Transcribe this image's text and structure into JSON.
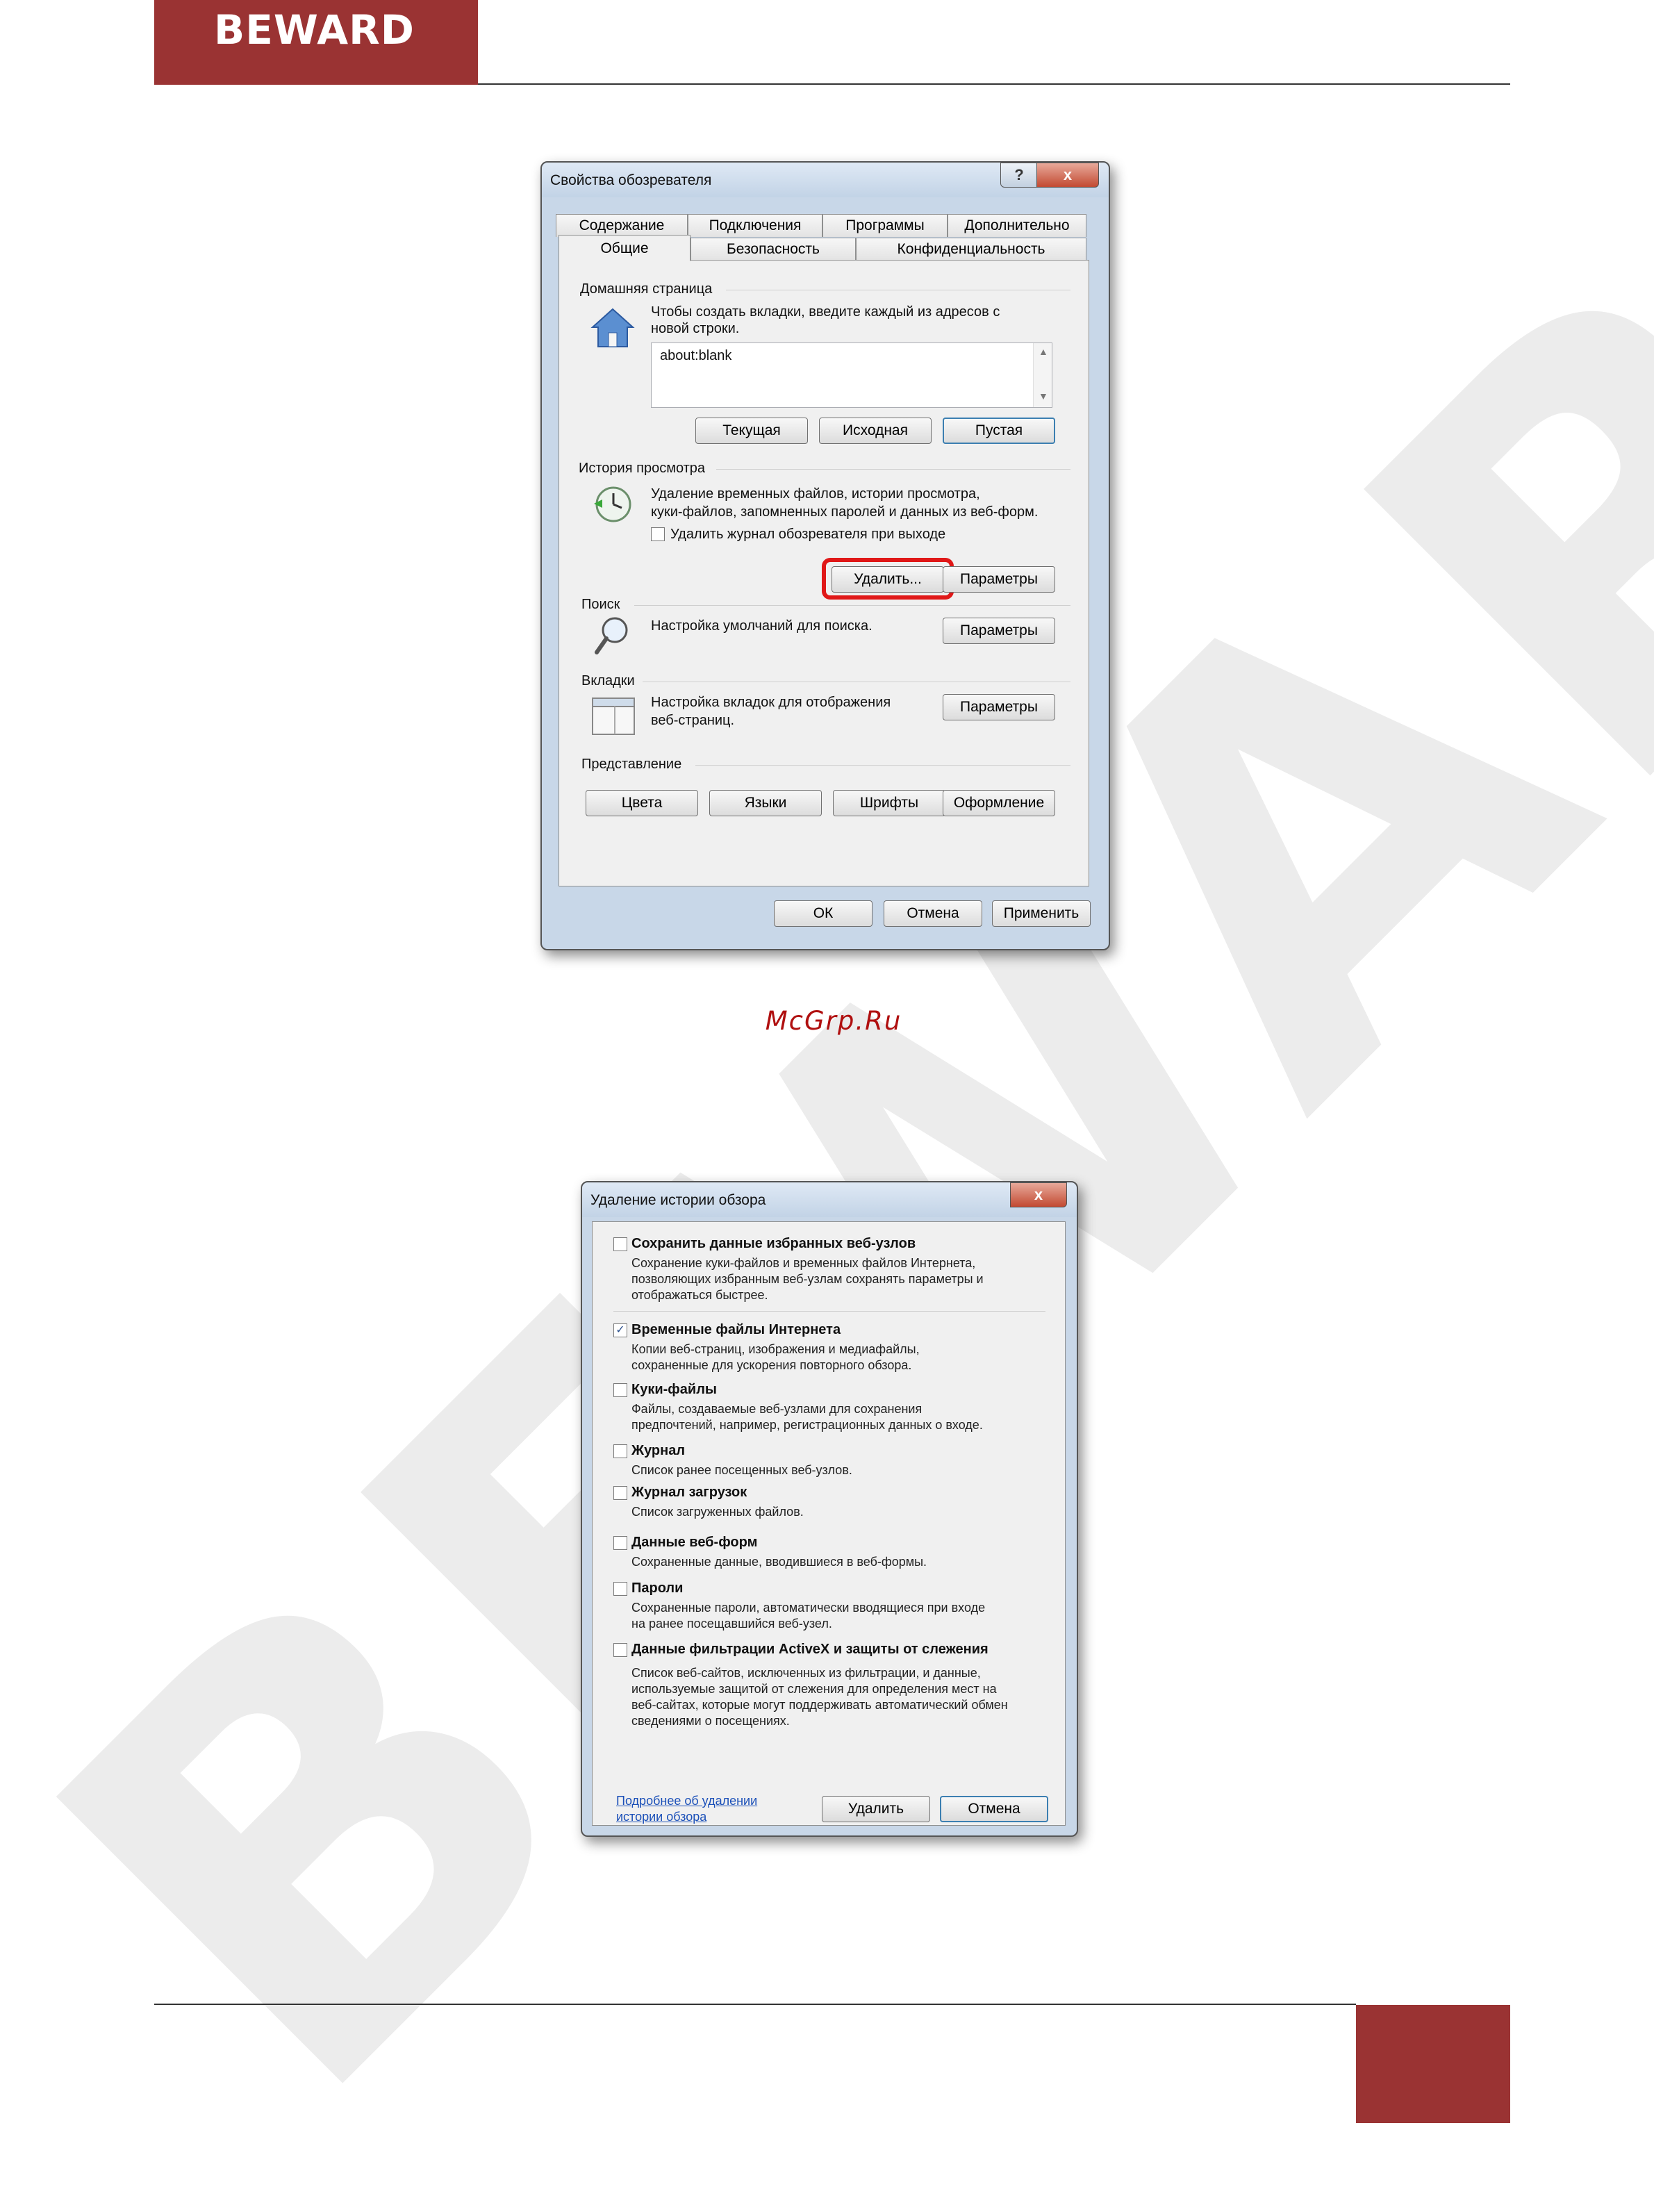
{
  "header": {
    "logo_text": "BEWARD"
  },
  "watermark": {
    "text": "BEWARD"
  },
  "site_tag": "McGrp.Ru",
  "colors": {
    "brand": "#9a3333",
    "dialog_frame": "#c8d7e8",
    "highlight": "#e01818",
    "link": "#1a4fb8"
  },
  "internet_options": {
    "title": "Свойства обозревателя",
    "help_icon": "?",
    "close_icon": "x",
    "tabs_row1": [
      "Содержание",
      "Подключения",
      "Программы",
      "Дополнительно"
    ],
    "tabs_row2": [
      "Общие",
      "Безопасность",
      "Конфиденциальность"
    ],
    "home": {
      "label": "Домашняя страница",
      "desc1": "Чтобы создать вкладки, введите каждый из адресов с",
      "desc2": "новой строки.",
      "value": "about:blank",
      "btn_current": "Текущая",
      "btn_default": "Исходная",
      "btn_blank": "Пустая"
    },
    "history": {
      "label": "История просмотра",
      "desc1": "Удаление временных файлов, истории просмотра,",
      "desc2": "куки-файлов, запомненных паролей и данных из веб-форм.",
      "checkbox_label": "Удалить журнал обозревателя при выходе",
      "btn_delete": "Удалить...",
      "btn_settings": "Параметры"
    },
    "search": {
      "label": "Поиск",
      "desc": "Настройка умолчаний для поиска.",
      "btn_settings": "Параметры"
    },
    "tabs_section": {
      "label": "Вкладки",
      "desc1": "Настройка вкладок для отображения",
      "desc2": "веб-страниц.",
      "btn_settings": "Параметры"
    },
    "appearance": {
      "label": "Представление",
      "btn_colors": "Цвета",
      "btn_languages": "Языки",
      "btn_fonts": "Шрифты",
      "btn_accessibility": "Оформление"
    },
    "footer": {
      "ok": "ОК",
      "cancel": "Отмена",
      "apply": "Применить"
    }
  },
  "delete_history": {
    "title": "Удаление истории обзора",
    "close_icon": "x",
    "items": [
      {
        "title": "Сохранить данные избранных веб-узлов",
        "checked": false,
        "desc": [
          "Сохранение куки-файлов и временных файлов Интернета,",
          "позволяющих избранным веб-узлам сохранять параметры и",
          "отображаться быстрее."
        ]
      },
      {
        "title": "Временные файлы Интернета",
        "checked": true,
        "desc": [
          "Копии веб-страниц, изображения и медиафайлы,",
          "сохраненные для ускорения повторного обзора."
        ]
      },
      {
        "title": "Куки-файлы",
        "checked": false,
        "desc": [
          "Файлы, создаваемые веб-узлами для сохранения",
          "предпочтений, например, регистрационных данных о входе."
        ]
      },
      {
        "title": "Журнал",
        "checked": false,
        "desc": [
          "Список ранее посещенных веб-узлов."
        ]
      },
      {
        "title": "Журнал загрузок",
        "checked": false,
        "desc": [
          "Список загруженных файлов."
        ]
      },
      {
        "title": "Данные веб-форм",
        "checked": false,
        "desc": [
          "Сохраненные данные, вводившиеся в веб-формы."
        ]
      },
      {
        "title": "Пароли",
        "checked": false,
        "desc": [
          "Сохраненные пароли, автоматически вводящиеся при входе",
          "на ранее посещавшийся веб-узел."
        ]
      },
      {
        "title": "Данные фильтрации ActiveX и защиты от слежения",
        "checked": false,
        "desc": [
          "Список веб-сайтов, исключенных из фильтрации, и данные,",
          "используемые защитой от слежения для определения мест на",
          "веб-сайтах, которые могут поддерживать автоматический обмен",
          "сведениями о посещениях."
        ]
      }
    ],
    "link1": "Подробнее об удалении",
    "link2": "истории обзора",
    "btn_delete": "Удалить",
    "btn_cancel": "Отмена"
  }
}
